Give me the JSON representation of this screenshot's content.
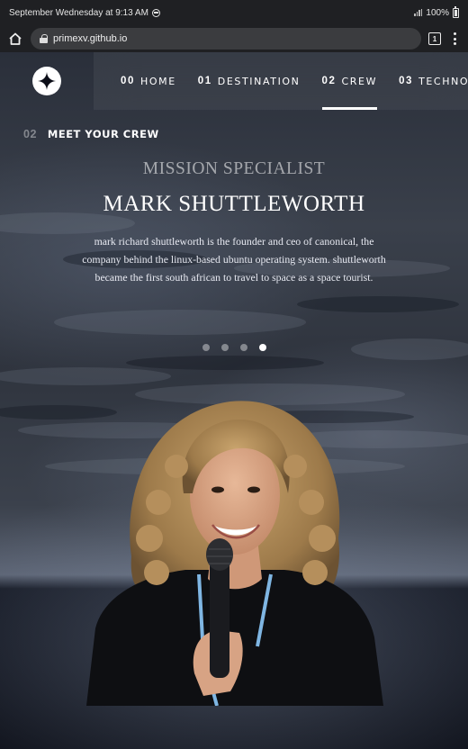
{
  "status_bar": {
    "time_text": "September Wednesday at 9:13 AM",
    "battery_text": "100%"
  },
  "browser": {
    "url": "primexv.github.io",
    "tab_count": "1"
  },
  "nav": {
    "items": [
      {
        "num": "00",
        "label": "HOME"
      },
      {
        "num": "01",
        "label": "DESTINATION"
      },
      {
        "num": "02",
        "label": "CREW",
        "active": true
      },
      {
        "num": "03",
        "label": "TECHNOLOGY"
      }
    ]
  },
  "heading": {
    "num": "02",
    "label": "MEET YOUR CREW"
  },
  "crew": {
    "role": "MISSION SPECIALIST",
    "name": "MARK SHUTTLEWORTH",
    "bio_lines": [
      "mark richard shuttleworth is the founder and ceo of canonical, the",
      "company behind the linux-based ubuntu operating system. shuttleworth",
      "became the first south african to travel to space as a space tourist."
    ],
    "slider_total": 4,
    "slider_active": 4
  },
  "colors": {
    "background": "#0b0d17",
    "accent": "#ffffff"
  },
  "icons": [
    "home-icon",
    "lock-icon",
    "tabs-icon",
    "menu-icon",
    "logo-star-icon",
    "do-not-disturb-icon",
    "signal-icon",
    "battery-icon"
  ]
}
